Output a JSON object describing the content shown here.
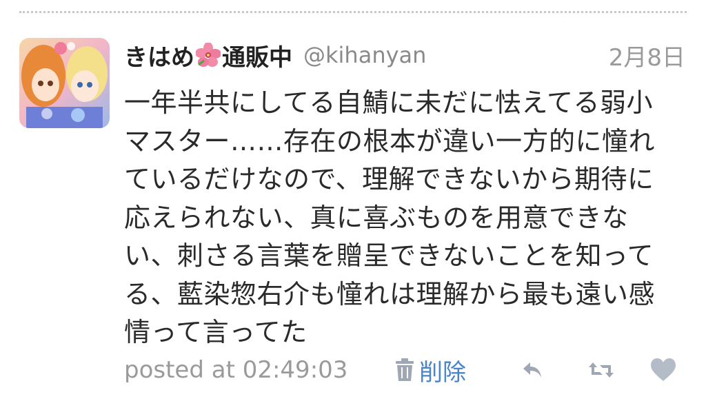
{
  "tweet": {
    "display_name": "きはめ",
    "display_name_suffix": "通販中",
    "flower_icon": "hibiscus-icon",
    "handle": "@kihanyan",
    "date": "2月8日",
    "text": "一年半共にしてる自鯖に未だに怯えてる弱小\nマスター……存在の根本が違い一方的に憧れ\nているだけなので、理解できないから期待に\n応えられない、真に喜ぶものを用意できな\nい、刺さる言葉を贈呈できないことを知って\nる、藍染惣右介も憧れは理解から最も遠い感\n情って言ってた",
    "posted_at": "posted at 02:49:03",
    "delete_label": "削除",
    "delete_icon": "trash-icon",
    "reply_icon": "reply-icon",
    "retweet_icon": "retweet-icon",
    "like_icon": "heart-icon"
  },
  "colors": {
    "name": "#222222",
    "muted": "#9a9a9a",
    "text": "#2a2a2a",
    "link": "#4a84c8",
    "icon": "#9ea7b3"
  }
}
